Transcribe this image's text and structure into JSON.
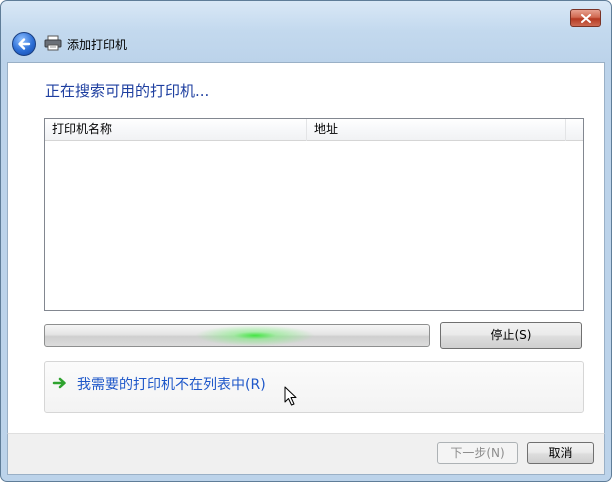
{
  "window": {
    "title": "添加打印机"
  },
  "content": {
    "heading": "正在搜索可用的打印机...",
    "list": {
      "columns": [
        "打印机名称",
        "地址"
      ],
      "rows": []
    },
    "progress": {
      "state": "searching-marquee"
    },
    "stop_button": "停止(S)",
    "not_listed_link": "我需要的打印机不在列表中(R)"
  },
  "footer": {
    "next_button": "下一步(N)",
    "cancel_button": "取消"
  },
  "icons": {
    "close": "close-icon",
    "back": "back-arrow-icon",
    "printer": "printer-icon",
    "link_arrow": "green-arrow-icon",
    "cursor": "mouse-cursor-icon"
  },
  "colors": {
    "heading": "#1e3fa0",
    "link": "#1e57c9",
    "progress_glow": "#3ce63c",
    "close_button": "#c2452c"
  }
}
